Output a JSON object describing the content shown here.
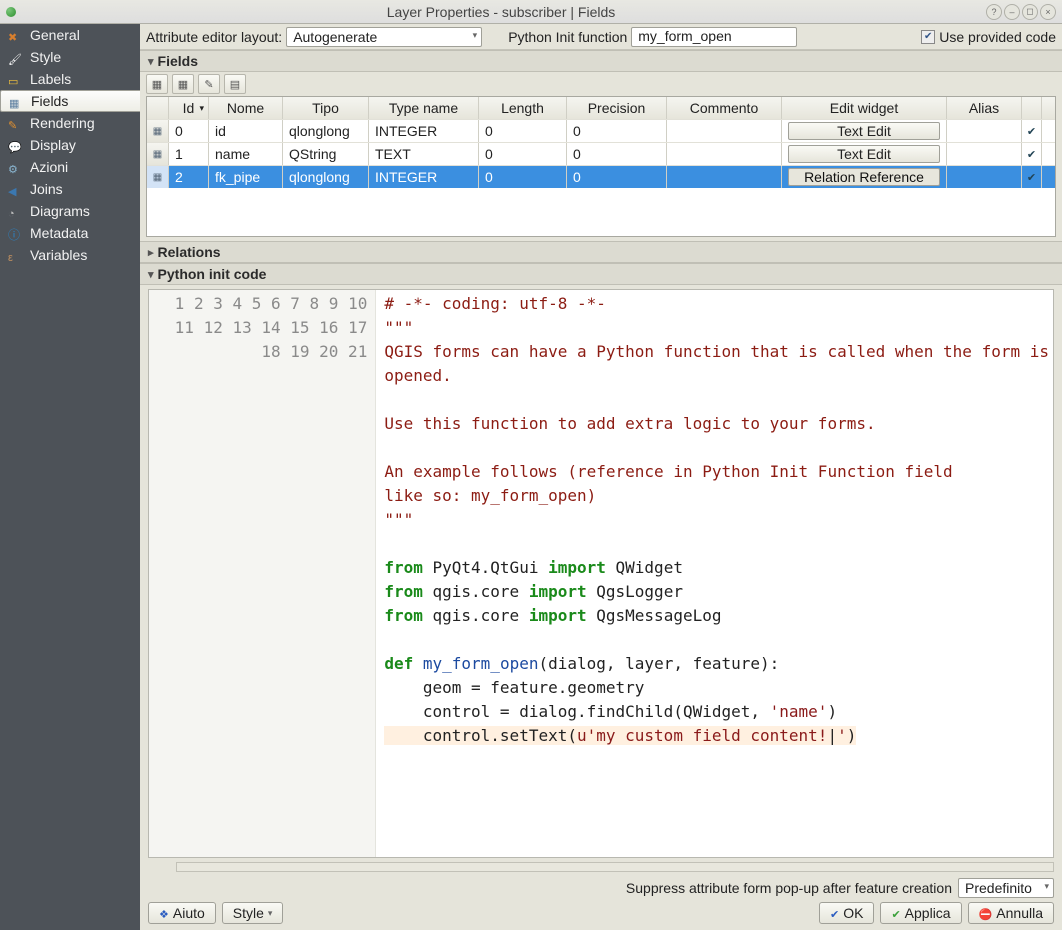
{
  "window": {
    "title": "Layer Properties - subscriber | Fields"
  },
  "sidebar": {
    "items": [
      {
        "label": "General",
        "icon": "ic-general",
        "selected": false
      },
      {
        "label": "Style",
        "icon": "ic-style",
        "selected": false
      },
      {
        "label": "Labels",
        "icon": "ic-labels",
        "selected": false
      },
      {
        "label": "Fields",
        "icon": "ic-fields",
        "selected": true
      },
      {
        "label": "Rendering",
        "icon": "ic-rendering",
        "selected": false
      },
      {
        "label": "Display",
        "icon": "ic-display",
        "selected": false
      },
      {
        "label": "Azioni",
        "icon": "ic-azioni",
        "selected": false
      },
      {
        "label": "Joins",
        "icon": "ic-joins",
        "selected": false
      },
      {
        "label": "Diagrams",
        "icon": "ic-diagrams",
        "selected": false
      },
      {
        "label": "Metadata",
        "icon": "ic-metadata",
        "selected": false
      },
      {
        "label": "Variables",
        "icon": "ic-variables",
        "selected": false
      }
    ]
  },
  "config": {
    "attr_editor_label": "Attribute editor layout:",
    "attr_editor_value": "Autogenerate",
    "py_init_label": "Python Init function",
    "py_init_value": "my_form_open",
    "use_provided_label": "Use provided code",
    "use_provided_checked": "✔"
  },
  "fields_section": {
    "title": "Fields",
    "headers": {
      "id": "Id",
      "nome": "Nome",
      "tipo": "Tipo",
      "typename": "Type name",
      "length": "Length",
      "precision": "Precision",
      "commento": "Commento",
      "edit": "Edit widget",
      "alias": "Alias"
    },
    "rows": [
      {
        "id": "0",
        "nome": "id",
        "tipo": "qlonglong",
        "typename": "INTEGER",
        "length": "0",
        "precision": "0",
        "commento": "",
        "edit": "Text Edit",
        "alias": "",
        "selected": false
      },
      {
        "id": "1",
        "nome": "name",
        "tipo": "QString",
        "typename": "TEXT",
        "length": "0",
        "precision": "0",
        "commento": "",
        "edit": "Text Edit",
        "alias": "",
        "selected": false
      },
      {
        "id": "2",
        "nome": "fk_pipe",
        "tipo": "qlonglong",
        "typename": "INTEGER",
        "length": "0",
        "precision": "0",
        "commento": "",
        "edit": "Relation Reference",
        "alias": "",
        "selected": true
      }
    ]
  },
  "relations_section": {
    "title": "Relations"
  },
  "code_section": {
    "title": "Python init code",
    "lines": [
      {
        "n": "1",
        "html": "<span class='c-red'># -*- coding: utf-8 -*-</span>"
      },
      {
        "n": "2",
        "html": "<span class='c-str'>\"\"\"</span>"
      },
      {
        "n": "3",
        "html": "<span class='c-str'>QGIS forms can have a Python function that is called when the form is</span>"
      },
      {
        "n": "4",
        "html": "<span class='c-str'>opened.</span>"
      },
      {
        "n": "5",
        "html": ""
      },
      {
        "n": "6",
        "html": "<span class='c-str'>Use this function to add extra logic to your forms.</span>"
      },
      {
        "n": "7",
        "html": ""
      },
      {
        "n": "8",
        "html": "<span class='c-str'>An example follows (reference in Python Init Function field</span>"
      },
      {
        "n": "9",
        "html": "<span class='c-str'>like so: my_form_open)</span>"
      },
      {
        "n": "10",
        "html": "<span class='c-str'>\"\"\"</span>"
      },
      {
        "n": "11",
        "html": ""
      },
      {
        "n": "12",
        "html": "<span class='c-kw'>from</span> PyQt4.QtGui <span class='c-kw'>import</span> QWidget"
      },
      {
        "n": "13",
        "html": "<span class='c-kw'>from</span> qgis.core <span class='c-kw'>import</span> QgsLogger"
      },
      {
        "n": "14",
        "html": "<span class='c-kw'>from</span> qgis.core <span class='c-kw'>import</span> QgsMessageLog"
      },
      {
        "n": "15",
        "html": ""
      },
      {
        "n": "16",
        "html": "<span class='c-def'>def</span> <span class='c-fn'>my_form_open</span>(dialog, layer, feature):"
      },
      {
        "n": "17",
        "html": "    geom = feature.geometry"
      },
      {
        "n": "18",
        "html": "    control = dialog.findChild(QWidget, <span class='c-lit'>'name'</span>)"
      },
      {
        "n": "19",
        "html": "<span class='c-hl'>    control.setText(<span class='c-ustr'>u'my custom field content!</span>|<span class='c-ustr'>'</span>)</span>"
      },
      {
        "n": "20",
        "html": ""
      },
      {
        "n": "21",
        "html": ""
      }
    ]
  },
  "suppress": {
    "label": "Suppress attribute form pop-up after feature creation",
    "value": "Predefinito"
  },
  "footer": {
    "aiuto": "Aiuto",
    "style": "Style",
    "ok": "OK",
    "applica": "Applica",
    "annulla": "Annulla"
  }
}
